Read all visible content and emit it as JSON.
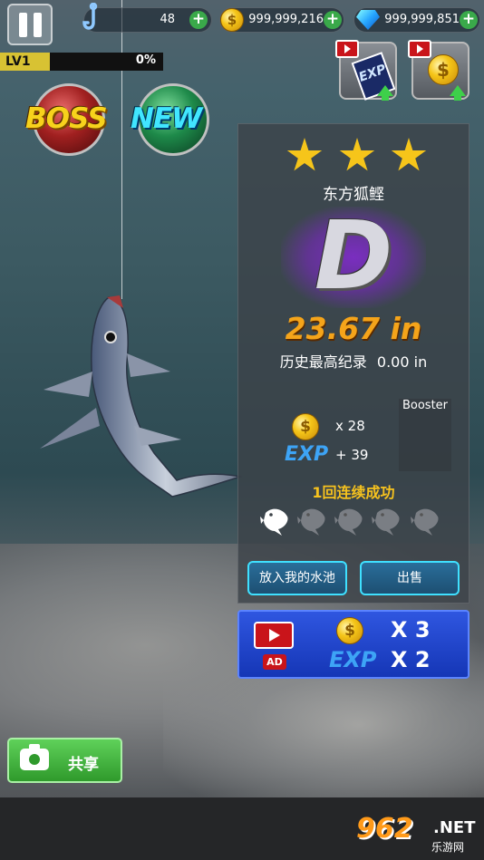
{
  "hud": {
    "hooks": "48",
    "coins": "999,999,216",
    "gems": "999,999,851",
    "level_label": "LV1",
    "level_progress": "0%",
    "level_progress_value": 0,
    "coin_glyph": "$"
  },
  "buttons": {
    "boss": "BOSS",
    "new": "NEW",
    "exp_card": "EXP",
    "share": "共享",
    "release": "放入我的水池",
    "sell": "出售"
  },
  "result": {
    "stars": 3,
    "fish_name": "东方狐鲣",
    "grade": "D",
    "size": "23.67 in",
    "record_label": "历史最高纪录",
    "record_value": "0.00 in",
    "booster_label": "Booster",
    "coin_reward": "x 28",
    "exp_label": "EXP",
    "exp_reward": "+ 39",
    "combo_text": "1回连续成功",
    "combo_count": 1,
    "combo_total": 5
  },
  "ad_bonus": {
    "ad_tag": "AD",
    "coin_mult": "X 3",
    "exp_label": "EXP",
    "exp_mult": "X 2"
  },
  "watermark": {
    "logo": "962",
    "net": ".NET",
    "sub": "乐游网"
  },
  "colors": {
    "accent_gold": "#f6c51a",
    "exp_blue": "#3da4f6",
    "button_border": "#3fe0ff",
    "share_green": "#2f9a2c",
    "size_orange": "#f5a41a"
  }
}
